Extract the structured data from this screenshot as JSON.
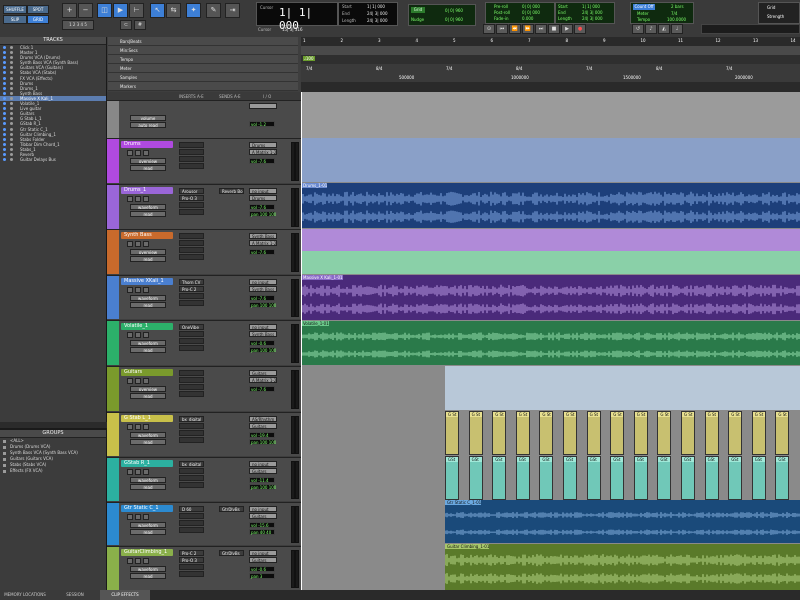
{
  "toolbar": {
    "edit_modes": [
      "SHUFFLE",
      "SPOT",
      "SLIP",
      "GRID"
    ],
    "main_counter": "1| 1| 000",
    "counter_mode": "Cursor",
    "cursor_value": "15| 3| 316",
    "start_label": "Start",
    "end_label": "End",
    "length_label": "Length",
    "start_value": "1| 1| 000",
    "end_value": "24| 3| 000",
    "length_value": "24| 3| 000",
    "grid_label": "Grid",
    "grid_value": "0| 0| 960",
    "nudge_label": "Nudge",
    "nudge_value": "0| 0| 960",
    "preroll_label": "Pre-roll",
    "postroll_label": "Post-roll",
    "fadein_label": "Fade-in",
    "pre_value": "0| 0| 000",
    "post_value": "0| 0| 000",
    "fade_value": "0.000",
    "start2_value": "1| 1| 000",
    "end2_value": "24| 3| 000",
    "len2_value": "24| 3| 000",
    "count_off": "Count Off",
    "count_off_value": "2 bars",
    "meter_label": "Meter",
    "meter_value": "7/4",
    "tempo_label": "Tempo",
    "tempo_value": "100.0000",
    "grid2_label": "Grid",
    "strength_label": "Strength"
  },
  "tracks_panel": {
    "title": "TRACKS",
    "items": [
      {
        "label": "Click 1"
      },
      {
        "label": "Master 1"
      },
      {
        "label": "Drums VCA (Drums)"
      },
      {
        "label": "Synth Bass VCA (Synth Bass)"
      },
      {
        "label": "Guitars VCA (Guitars)"
      },
      {
        "label": "Stabs VCA (Stabs)"
      },
      {
        "label": "FX VCA (Effects)"
      },
      {
        "label": "Drums"
      },
      {
        "label": "Drums_1"
      },
      {
        "label": "Synth Bass"
      },
      {
        "label": "Massive X Kali_1"
      },
      {
        "label": "Volatile_1"
      },
      {
        "label": "Live guitar"
      },
      {
        "label": "Guitars"
      },
      {
        "label": "G Stab L_1"
      },
      {
        "label": "GStab R_1"
      },
      {
        "label": "Gtr Static C_1"
      },
      {
        "label": "Guitar Climbing_1"
      },
      {
        "label": "Stabs Folder"
      },
      {
        "label": "Tibbar Dim Chord_1"
      },
      {
        "label": "Stabs_1"
      },
      {
        "label": "Reverb"
      },
      {
        "label": "Guitar Delays Bus"
      }
    ],
    "selected_index": 10
  },
  "groups_panel": {
    "title": "GROUPS",
    "items": [
      {
        "label": "<ALL>"
      },
      {
        "label": "Drums (Drums VCA)"
      },
      {
        "label": "Synth Bass VCA (Synth Bass VCA)"
      },
      {
        "label": "Guitars (Guitars VCA)"
      },
      {
        "label": "Stabs (Stabs VCA)"
      },
      {
        "label": "Effects (FX VCA)"
      }
    ]
  },
  "header_labels": {
    "inserts": "INSERTS A-E",
    "sends": "SENDS A-E",
    "io": "I / O"
  },
  "rulers": [
    {
      "label": "Bars|Beats"
    },
    {
      "label": "Min:Secs"
    },
    {
      "label": "Tempo"
    },
    {
      "label": "Meter"
    },
    {
      "label": "Samples"
    },
    {
      "label": "Markers"
    }
  ],
  "bar_numbers": [
    "1",
    "2",
    "3",
    "4",
    "5",
    "6",
    "7",
    "8",
    "9",
    "10",
    "11",
    "12",
    "13",
    "14"
  ],
  "tempo_marker": "♩100",
  "meter_marks": [
    "7/4",
    "8/4",
    "7/4",
    "8/4",
    "7/4",
    "8/4",
    "7/4"
  ],
  "samples_marks": [
    "500000",
    "1000000",
    "1500000",
    "2000000"
  ],
  "track_headers": [
    {
      "name": "Drums",
      "color": "#b04ae0",
      "view": "overview",
      "io_in": "Drums",
      "io_out": "A Matrix 1-2",
      "vol": "-7.6"
    },
    {
      "name": "Drums_1",
      "color": "#9a66d8",
      "view": "waveform",
      "insert1": "Arousor",
      "insert2": "Pro-Q 3",
      "send": "Reverb Bo",
      "io_in": "no input",
      "io_out": "Drums",
      "vol": "-7.6",
      "pan": "100 100"
    },
    {
      "name": "Synth Bass",
      "color": "#c86a2c",
      "view": "overview",
      "io_in": "Synth Bass",
      "io_out": "A Matrix 1-2",
      "vol": "-7.6"
    },
    {
      "name": "Massive XKali_1",
      "color": "#4a7fd0",
      "view": "waveform",
      "insert1": "Thorn CV",
      "insert2": "Pro-C 2",
      "io_in": "no input",
      "io_out": "Synth Bass",
      "vol": "-7.6",
      "pan": "100 100"
    },
    {
      "name": "Volatile_1",
      "color": "#2cb06a",
      "view": "waveform",
      "insert1": "OneVibe",
      "io_in": "no input",
      "io_out": "Synth Bass",
      "vol": "-0.6",
      "pan": "100 100"
    },
    {
      "name": "Guitars",
      "color": "#7a9a2c",
      "view": "overview",
      "io_in": "Guitars",
      "io_out": "A Matrix 1-2",
      "vol": "-7.6"
    },
    {
      "name": "G Stab L_1",
      "color": "#c8c04a",
      "view": "waveform",
      "insert1": "bx_digital",
      "io_in": "AS/Rhythm",
      "io_out": "Guitars",
      "vol": "-19.4",
      "pan": "100 100"
    },
    {
      "name": "GStab R_1",
      "color": "#2cb0a0",
      "view": "waveform",
      "insert1": "bx_digital",
      "io_in": "no input",
      "io_out": "Guitars",
      "vol": "-11.4",
      "pan": "100 100"
    },
    {
      "name": "Gtr Static C_1",
      "color": "#2c8ad0",
      "view": "waveform",
      "insert1": "D 60",
      "send": "GtrDlyBs",
      "io_in": "no input",
      "io_out": "Guitars",
      "vol": "-15.6",
      "pan": "40 40"
    },
    {
      "name": "GuitarClimbing_1",
      "color": "#8ab04a",
      "view": "waveform",
      "insert1": "Pro-C 2",
      "insert2": "Pro-Q 3",
      "send": "GtrDlyBs",
      "io_in": "no input",
      "io_out": "Guitars",
      "vol": "-0.6",
      "pan": "3"
    }
  ],
  "clip_names": {
    "drums": "Drums_1-01",
    "massive": "Massive X Kali_1-01",
    "volatile": "Volatile_1-01",
    "static": "Gtr Static C_1-01",
    "climbing": "Guitar Climbing_1-01",
    "gstab_l": "G St",
    "gstab_r": "GSt"
  },
  "bottom_tabs": [
    "MEMORY LOCATIONS",
    "SESSION",
    "CLIP EFFECTS"
  ]
}
